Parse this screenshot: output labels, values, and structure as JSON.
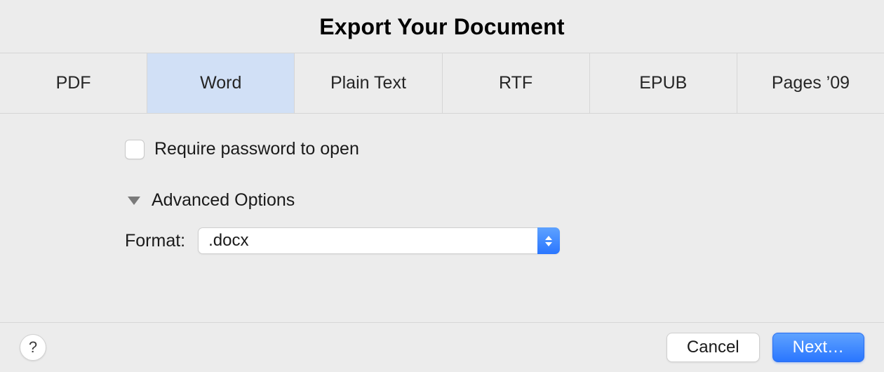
{
  "title": "Export Your Document",
  "tabs": [
    {
      "label": "PDF",
      "selected": false
    },
    {
      "label": "Word",
      "selected": true
    },
    {
      "label": "Plain Text",
      "selected": false
    },
    {
      "label": "RTF",
      "selected": false
    },
    {
      "label": "EPUB",
      "selected": false
    },
    {
      "label": "Pages ’09",
      "selected": false
    }
  ],
  "options": {
    "require_password_label": "Require password to open",
    "require_password_checked": false,
    "advanced_label": "Advanced Options",
    "advanced_expanded": true,
    "format_label": "Format:",
    "format_value": ".docx"
  },
  "footer": {
    "help_label": "?",
    "cancel_label": "Cancel",
    "next_label": "Next…"
  }
}
